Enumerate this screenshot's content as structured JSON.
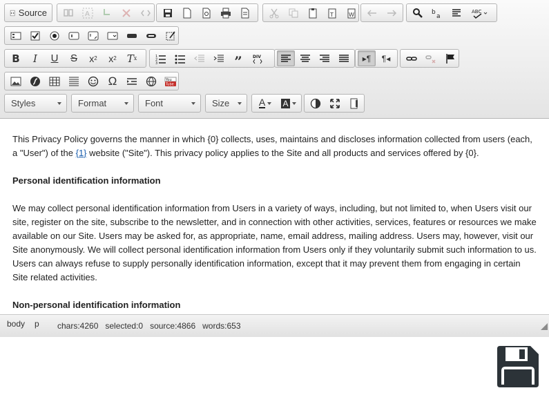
{
  "toolbar": {
    "source_label": "Source",
    "styles_label": "Styles",
    "format_label": "Format",
    "font_label": "Font",
    "size_label": "Size",
    "div_label": "DIV"
  },
  "content": {
    "p1_before": "This Privacy Policy governs the manner in which {0} collects, uses, maintains and discloses information collected from users (each, a \"User\") of the ",
    "p1_link": "{1}",
    "p1_after": " website (\"Site\"). This privacy policy applies to the Site and all products and services offered by {0}.",
    "h1": "Personal identification information",
    "p2": "We may collect personal identification information from Users in a variety of ways, including, but not limited to, when Users visit our site, register on the site, subscribe to the newsletter, and in connection with other activities, services, features or resources we make available on our Site. Users may be asked for, as appropriate, name, email address, mailing address. Users may, however, visit our Site anonymously. We will collect personal identification information from Users only if they voluntarily submit such information to us. Users can always refuse to supply personally identification information, except that it may prevent them from engaging in certain Site related activities.",
    "h2": "Non-personal identification information"
  },
  "status": {
    "path": [
      "body",
      "p"
    ],
    "chars": "chars:4260",
    "selected": "selected:0",
    "source": "source:4866",
    "words": "words:653"
  },
  "icons": {
    "youtube_text": "You Tube",
    "omega": "Ω",
    "text_color_letter": "A"
  }
}
